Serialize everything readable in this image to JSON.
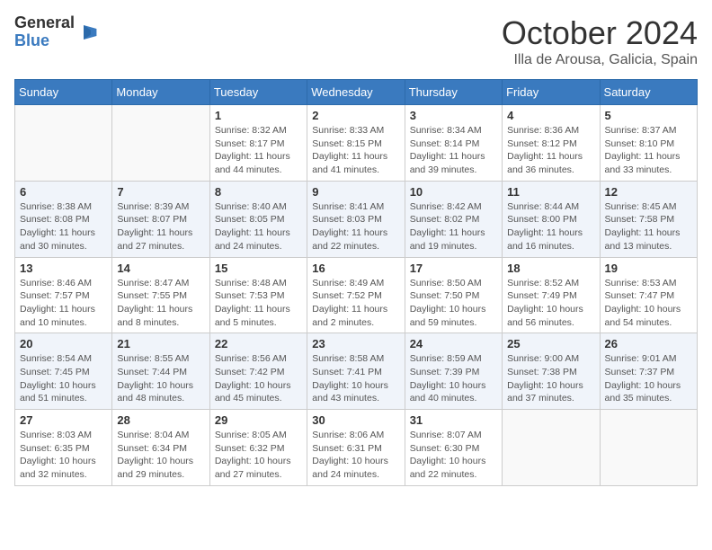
{
  "logo": {
    "general": "General",
    "blue": "Blue"
  },
  "title": "October 2024",
  "location": "Illa de Arousa, Galicia, Spain",
  "days_of_week": [
    "Sunday",
    "Monday",
    "Tuesday",
    "Wednesday",
    "Thursday",
    "Friday",
    "Saturday"
  ],
  "weeks": [
    [
      {
        "day": "",
        "info": ""
      },
      {
        "day": "",
        "info": ""
      },
      {
        "day": "1",
        "info": "Sunrise: 8:32 AM\nSunset: 8:17 PM\nDaylight: 11 hours and 44 minutes."
      },
      {
        "day": "2",
        "info": "Sunrise: 8:33 AM\nSunset: 8:15 PM\nDaylight: 11 hours and 41 minutes."
      },
      {
        "day": "3",
        "info": "Sunrise: 8:34 AM\nSunset: 8:14 PM\nDaylight: 11 hours and 39 minutes."
      },
      {
        "day": "4",
        "info": "Sunrise: 8:36 AM\nSunset: 8:12 PM\nDaylight: 11 hours and 36 minutes."
      },
      {
        "day": "5",
        "info": "Sunrise: 8:37 AM\nSunset: 8:10 PM\nDaylight: 11 hours and 33 minutes."
      }
    ],
    [
      {
        "day": "6",
        "info": "Sunrise: 8:38 AM\nSunset: 8:08 PM\nDaylight: 11 hours and 30 minutes."
      },
      {
        "day": "7",
        "info": "Sunrise: 8:39 AM\nSunset: 8:07 PM\nDaylight: 11 hours and 27 minutes."
      },
      {
        "day": "8",
        "info": "Sunrise: 8:40 AM\nSunset: 8:05 PM\nDaylight: 11 hours and 24 minutes."
      },
      {
        "day": "9",
        "info": "Sunrise: 8:41 AM\nSunset: 8:03 PM\nDaylight: 11 hours and 22 minutes."
      },
      {
        "day": "10",
        "info": "Sunrise: 8:42 AM\nSunset: 8:02 PM\nDaylight: 11 hours and 19 minutes."
      },
      {
        "day": "11",
        "info": "Sunrise: 8:44 AM\nSunset: 8:00 PM\nDaylight: 11 hours and 16 minutes."
      },
      {
        "day": "12",
        "info": "Sunrise: 8:45 AM\nSunset: 7:58 PM\nDaylight: 11 hours and 13 minutes."
      }
    ],
    [
      {
        "day": "13",
        "info": "Sunrise: 8:46 AM\nSunset: 7:57 PM\nDaylight: 11 hours and 10 minutes."
      },
      {
        "day": "14",
        "info": "Sunrise: 8:47 AM\nSunset: 7:55 PM\nDaylight: 11 hours and 8 minutes."
      },
      {
        "day": "15",
        "info": "Sunrise: 8:48 AM\nSunset: 7:53 PM\nDaylight: 11 hours and 5 minutes."
      },
      {
        "day": "16",
        "info": "Sunrise: 8:49 AM\nSunset: 7:52 PM\nDaylight: 11 hours and 2 minutes."
      },
      {
        "day": "17",
        "info": "Sunrise: 8:50 AM\nSunset: 7:50 PM\nDaylight: 10 hours and 59 minutes."
      },
      {
        "day": "18",
        "info": "Sunrise: 8:52 AM\nSunset: 7:49 PM\nDaylight: 10 hours and 56 minutes."
      },
      {
        "day": "19",
        "info": "Sunrise: 8:53 AM\nSunset: 7:47 PM\nDaylight: 10 hours and 54 minutes."
      }
    ],
    [
      {
        "day": "20",
        "info": "Sunrise: 8:54 AM\nSunset: 7:45 PM\nDaylight: 10 hours and 51 minutes."
      },
      {
        "day": "21",
        "info": "Sunrise: 8:55 AM\nSunset: 7:44 PM\nDaylight: 10 hours and 48 minutes."
      },
      {
        "day": "22",
        "info": "Sunrise: 8:56 AM\nSunset: 7:42 PM\nDaylight: 10 hours and 45 minutes."
      },
      {
        "day": "23",
        "info": "Sunrise: 8:58 AM\nSunset: 7:41 PM\nDaylight: 10 hours and 43 minutes."
      },
      {
        "day": "24",
        "info": "Sunrise: 8:59 AM\nSunset: 7:39 PM\nDaylight: 10 hours and 40 minutes."
      },
      {
        "day": "25",
        "info": "Sunrise: 9:00 AM\nSunset: 7:38 PM\nDaylight: 10 hours and 37 minutes."
      },
      {
        "day": "26",
        "info": "Sunrise: 9:01 AM\nSunset: 7:37 PM\nDaylight: 10 hours and 35 minutes."
      }
    ],
    [
      {
        "day": "27",
        "info": "Sunrise: 8:03 AM\nSunset: 6:35 PM\nDaylight: 10 hours and 32 minutes."
      },
      {
        "day": "28",
        "info": "Sunrise: 8:04 AM\nSunset: 6:34 PM\nDaylight: 10 hours and 29 minutes."
      },
      {
        "day": "29",
        "info": "Sunrise: 8:05 AM\nSunset: 6:32 PM\nDaylight: 10 hours and 27 minutes."
      },
      {
        "day": "30",
        "info": "Sunrise: 8:06 AM\nSunset: 6:31 PM\nDaylight: 10 hours and 24 minutes."
      },
      {
        "day": "31",
        "info": "Sunrise: 8:07 AM\nSunset: 6:30 PM\nDaylight: 10 hours and 22 minutes."
      },
      {
        "day": "",
        "info": ""
      },
      {
        "day": "",
        "info": ""
      }
    ]
  ]
}
